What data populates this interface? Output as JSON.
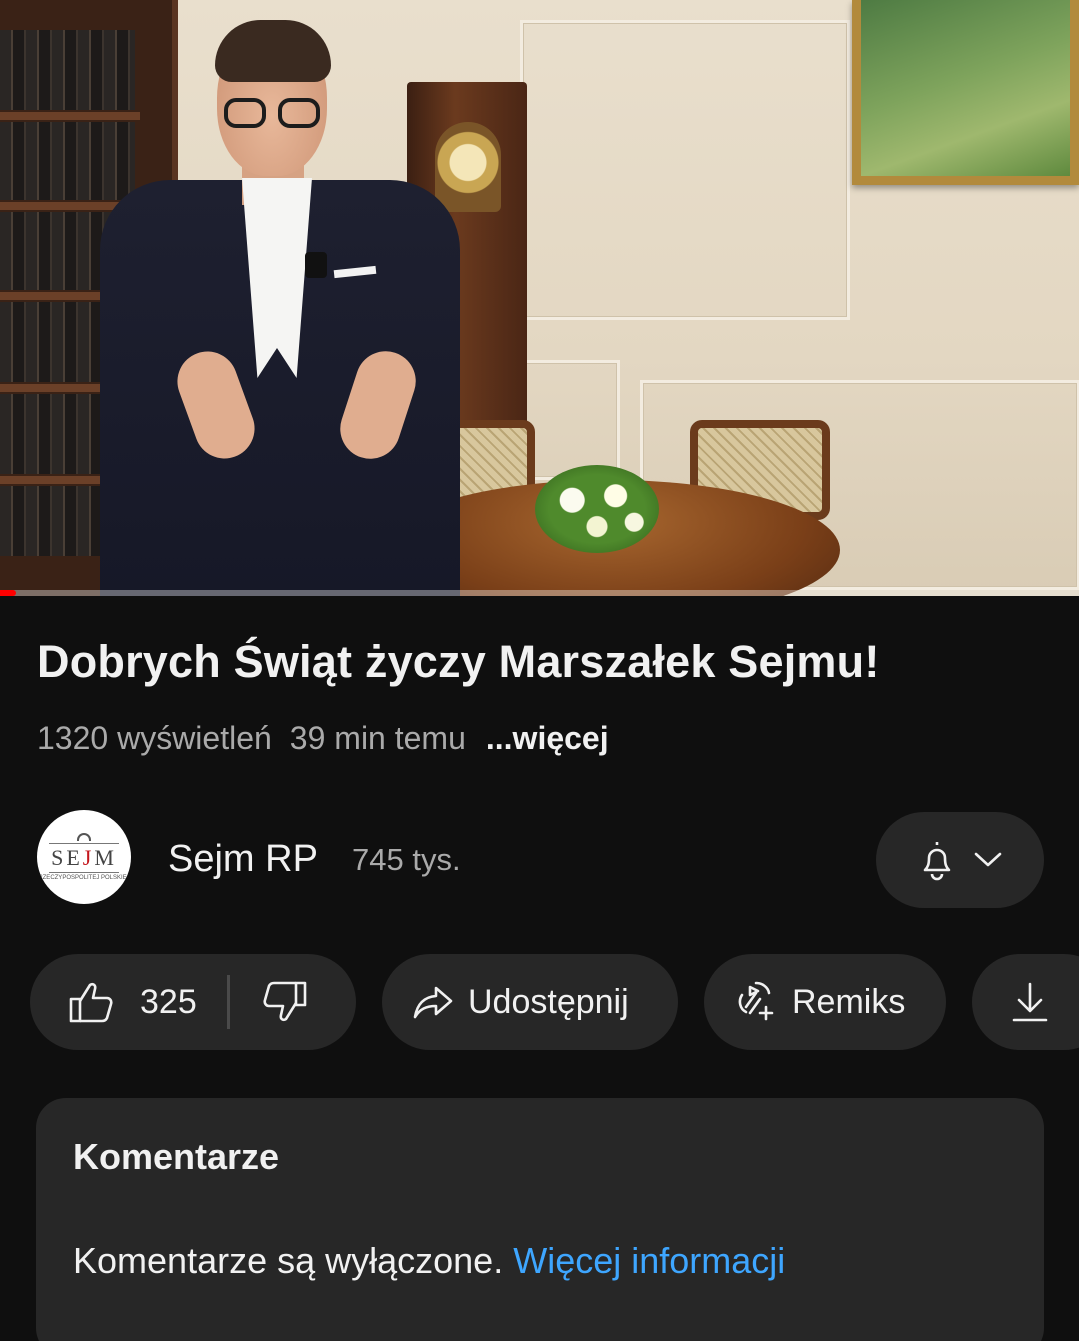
{
  "video": {
    "progress_fraction": 0.01,
    "scene": "speaker-in-office-thumbnail"
  },
  "title": "Dobrych Świąt życzy Marszałek Sejmu!",
  "meta": {
    "views": "1320 wyświetleń",
    "time": "39 min temu",
    "more": "...więcej"
  },
  "channel": {
    "name": "Sejm RP",
    "subscribers": "745 tys.",
    "avatar_logo": "SEJM",
    "avatar_logo_left": "SE",
    "avatar_logo_mid": "J",
    "avatar_logo_right": "M",
    "avatar_subtext": "RZECZYPOSPOLITEJ POLSKIEJ",
    "bell_icon": "bell-icon",
    "dropdown_icon": "chevron-down-icon"
  },
  "actions": {
    "like_count": "325",
    "like_icon": "thumbs-up-icon",
    "dislike_icon": "thumbs-down-icon",
    "share_label": "Udostępnij",
    "share_icon": "share-arrow-icon",
    "remix_label": "Remiks",
    "remix_icon": "remix-icon",
    "download_icon": "download-icon"
  },
  "comments": {
    "heading": "Komentarze",
    "disabled_text": "Komentarze są wyłączone.",
    "link_text": "Więcej informacji",
    "link_color": "#3ea6ff"
  },
  "colors": {
    "background": "#0f0f0f",
    "surface": "#272727",
    "primary_text": "#f1f1f1",
    "secondary_text": "#aaaaaa",
    "progress": "#ff0000"
  }
}
